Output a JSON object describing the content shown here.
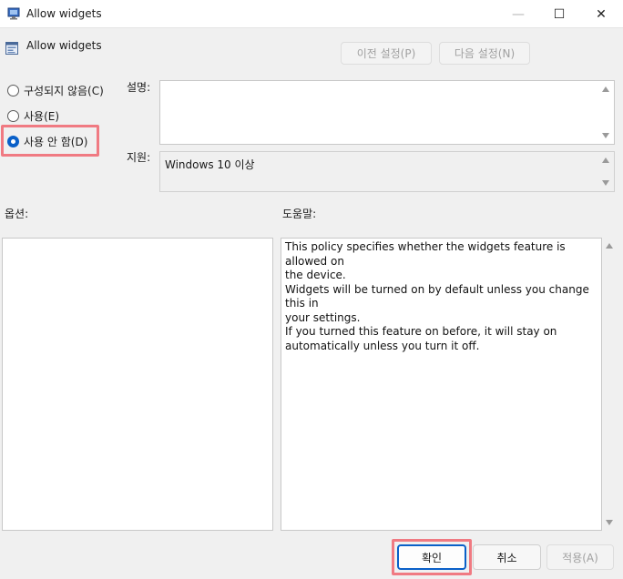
{
  "window": {
    "title": "Allow widgets",
    "controls": {
      "minimize": "—",
      "maximize": "☐",
      "close": "✕"
    }
  },
  "header": {
    "title": "Allow widgets",
    "prev_setting_label": "이전 설정(P)",
    "next_setting_label": "다음 설정(N)"
  },
  "state": {
    "options": [
      {
        "label": "구성되지 않음(C)",
        "checked": false
      },
      {
        "label": "사용(E)",
        "checked": false
      },
      {
        "label": "사용 안 함(D)",
        "checked": true
      }
    ]
  },
  "labels": {
    "description": "설명:",
    "supported": "지원:",
    "options": "옵션:",
    "help": "도움말:"
  },
  "supported_on": "Windows 10 이상",
  "help_lines": [
    "This policy specifies whether the widgets feature is allowed on",
    "the device.",
    "Widgets will be turned on by default unless you change this in",
    "your settings.",
    "If you turned this feature on before, it will stay on",
    "automatically unless you turn it off."
  ],
  "footer": {
    "ok_label": "확인",
    "cancel_label": "취소",
    "apply_label": "적용(A)"
  },
  "colors": {
    "accent": "#0a60c8",
    "highlight": "#f07a82"
  },
  "icons": {
    "app": "group-policy-icon",
    "header": "policy-setting-icon"
  }
}
